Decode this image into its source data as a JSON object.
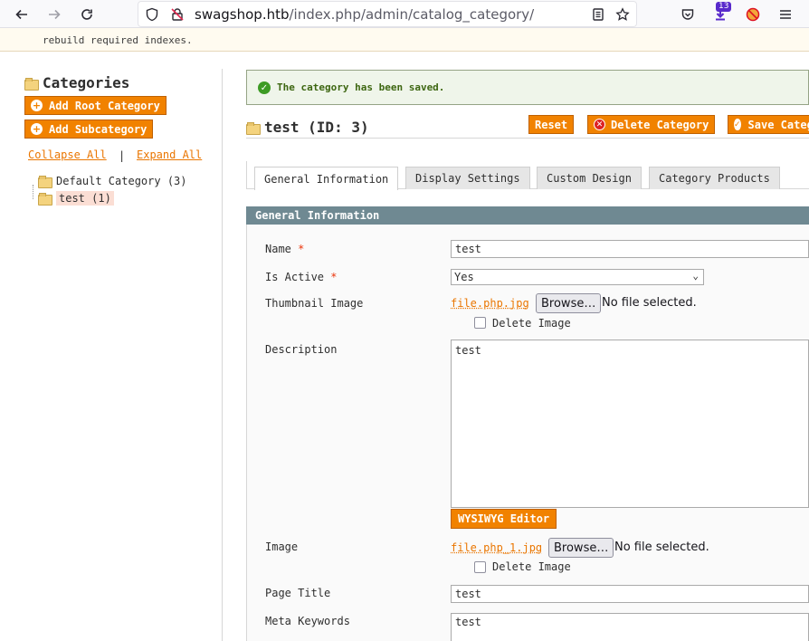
{
  "browser": {
    "url_host": "swagshop.htb",
    "url_path": "/index.php/admin/catalog_category/",
    "extensions_badge": "13"
  },
  "notice": {
    "text": "rebuild required indexes."
  },
  "sidebar": {
    "title": "Categories",
    "add_root_label": "Add Root Category",
    "add_sub_label": "Add Subcategory",
    "collapse_all": "Collapse All",
    "separator": "|",
    "expand_all": "Expand All",
    "tree": [
      {
        "label": "Default Category (3)"
      },
      {
        "label": "test (1)"
      }
    ]
  },
  "success_message": "The category has been saved.",
  "header": {
    "title": "test (ID: 3)",
    "reset_label": "Reset",
    "delete_label": "Delete Category",
    "save_label": "Save Category"
  },
  "tabs": [
    {
      "label": "General Information"
    },
    {
      "label": "Display Settings"
    },
    {
      "label": "Custom Design"
    },
    {
      "label": "Category Products"
    }
  ],
  "section_title": "General Information",
  "form": {
    "name_label": "Name",
    "name_value": "test",
    "required_mark": "*",
    "active_label": "Is Active",
    "active_value": "Yes",
    "thumb_label": "Thumbnail Image",
    "thumb_file": "file.php.jpg",
    "browse_label": "Browse…",
    "no_file": "No file selected.",
    "delete_image_label": "Delete Image",
    "description_label": "Description",
    "description_value": "test",
    "wysiwyg_label": "WYSIWYG Editor",
    "image_label": "Image",
    "image_file": "file.php_1.jpg",
    "page_title_label": "Page Title",
    "page_title_value": "test",
    "meta_keywords_label": "Meta Keywords",
    "meta_keywords_value": "test"
  }
}
